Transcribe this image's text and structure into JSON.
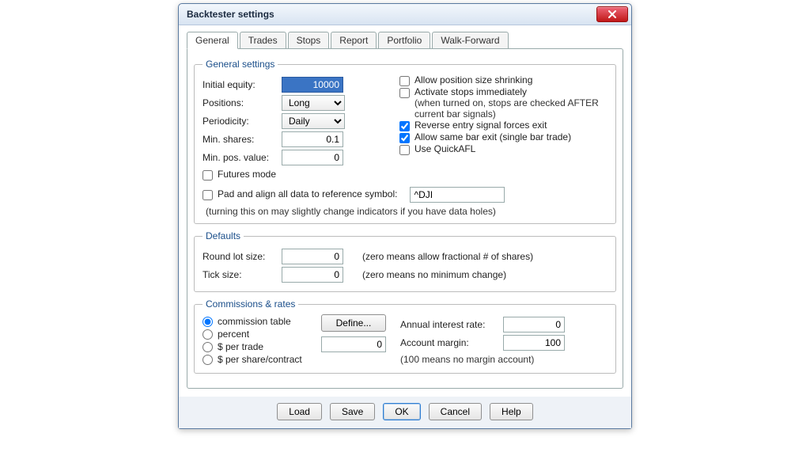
{
  "window": {
    "title": "Backtester settings"
  },
  "tabs": [
    "General",
    "Trades",
    "Stops",
    "Report",
    "Portfolio",
    "Walk-Forward"
  ],
  "general": {
    "legend": "General settings",
    "initial_equity_label": "Initial equity:",
    "initial_equity": "10000",
    "positions_label": "Positions:",
    "positions": "Long",
    "periodicity_label": "Periodicity:",
    "periodicity": "Daily",
    "min_shares_label": "Min. shares:",
    "min_shares": "0.1",
    "min_pos_value_label": "Min. pos. value:",
    "min_pos_value": "0",
    "futures_mode_label": "Futures mode",
    "pad_align_label": "Pad and align all data to reference symbol:",
    "pad_align_symbol": "^DJI",
    "pad_align_hint": "(turning this on may slightly change indicators if you have data holes)",
    "cb_allow_shrink": "Allow position size shrinking",
    "cb_activate_stops": "Activate stops immediately",
    "cb_activate_stops_sub": "(when turned on, stops are checked AFTER current bar signals)",
    "cb_reverse_exit": "Reverse entry signal forces exit",
    "cb_same_bar_exit": "Allow same bar exit (single bar trade)",
    "cb_quickafl": "Use QuickAFL"
  },
  "defaults": {
    "legend": "Defaults",
    "round_lot_label": "Round lot size:",
    "round_lot": "0",
    "round_lot_hint": "(zero means allow fractional # of shares)",
    "tick_size_label": "Tick size:",
    "tick_size": "0",
    "tick_size_hint": "(zero means no minimum change)"
  },
  "commissions": {
    "legend": "Commissions & rates",
    "r_table": "commission table",
    "r_percent": "percent",
    "r_per_trade": "$ per trade",
    "r_per_share": "$ per share/contract",
    "define_btn": "Define...",
    "comm_value": "0",
    "annual_interest_label": "Annual interest rate:",
    "annual_interest": "0",
    "account_margin_label": "Account margin:",
    "account_margin": "100",
    "margin_hint": "(100 means no margin account)"
  },
  "buttons": {
    "load": "Load",
    "save": "Save",
    "ok": "OK",
    "cancel": "Cancel",
    "help": "Help"
  }
}
